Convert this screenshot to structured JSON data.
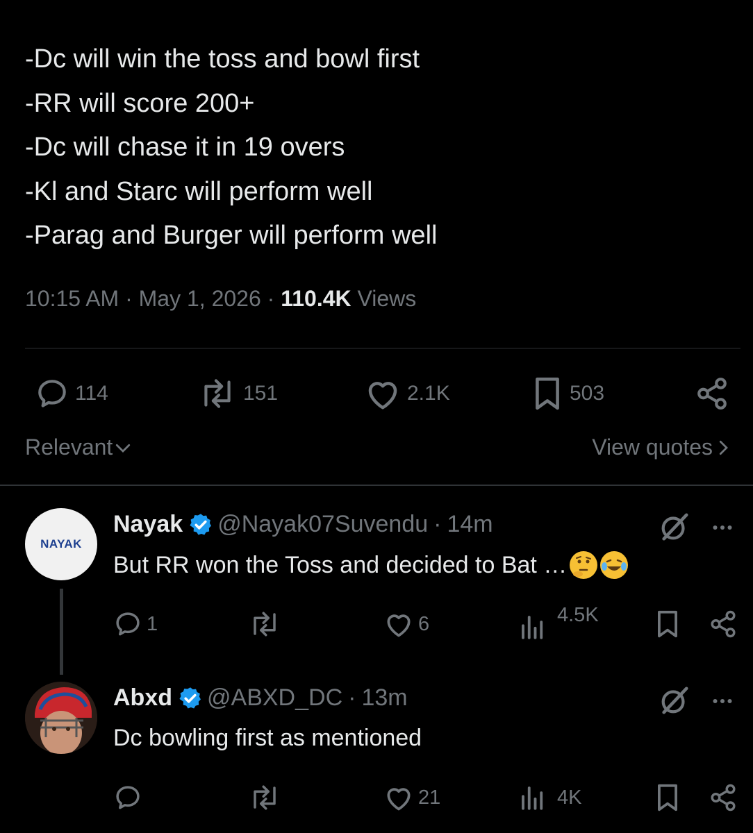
{
  "tweet": {
    "lines": [
      "-Dc will win the toss and bowl first",
      "-RR will score 200+",
      "-Dc will chase it in 19 overs",
      "-Kl and Starc will perform well",
      "-Parag and Burger will perform well"
    ],
    "time": "10:15 AM",
    "date": "May 1, 2026",
    "separator": "·",
    "views_count": "110.4K",
    "views_label": "Views"
  },
  "actions": {
    "replies": "114",
    "reposts": "151",
    "likes": "2.1K",
    "bookmarks": "503"
  },
  "sort": {
    "label": "Relevant",
    "view_quotes": "View quotes"
  },
  "replies": [
    {
      "avatar_text": "NAYAK",
      "name": "Nayak",
      "handle": "@Nayak07Suvendu",
      "time": "14m",
      "text": "But RR won the Toss and decided to Bat …",
      "emojis": [
        "thinking-face",
        "laughing-tears-face"
      ],
      "replies": "1",
      "reposts": "",
      "likes": "6",
      "views": "4.5K"
    },
    {
      "name": "Abxd",
      "handle": "@ABXD_DC",
      "time": "13m",
      "text": "Dc bowling first as mentioned",
      "replies": "",
      "reposts": "",
      "likes": "21",
      "views": "4K"
    }
  ],
  "colors": {
    "background": "#000000",
    "text": "#e7e9ea",
    "muted": "#71767b",
    "divider": "#2f3336",
    "verified": "#1d9bf0"
  }
}
